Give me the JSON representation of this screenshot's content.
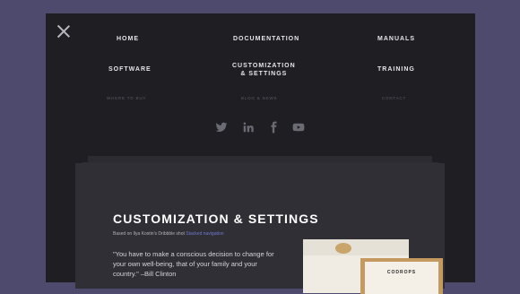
{
  "menu": {
    "primary": [
      {
        "id": "home",
        "label": "HOME"
      },
      {
        "id": "documentation",
        "label": "DOCUMENTATION"
      },
      {
        "id": "manuals",
        "label": "MANUALS"
      },
      {
        "id": "software",
        "label": "SOFTWARE"
      },
      {
        "id": "customization_1",
        "label": "CUSTOMIZATION"
      },
      {
        "id": "customization_2",
        "label": "& SETTINGS"
      },
      {
        "id": "training",
        "label": "TRAINING"
      }
    ],
    "secondary": [
      {
        "id": "where_to_buy",
        "label": "WHERE TO BUY"
      },
      {
        "id": "blog_news",
        "label": "BLOG & NEWS"
      },
      {
        "id": "contact",
        "label": "CONTACT"
      }
    ],
    "social": [
      {
        "id": "twitter",
        "icon": "twitter-icon"
      },
      {
        "id": "linkedin",
        "icon": "linkedin-icon"
      },
      {
        "id": "facebook",
        "icon": "facebook-icon"
      },
      {
        "id": "youtube",
        "icon": "youtube-icon"
      }
    ]
  },
  "card": {
    "title": "CUSTOMIZATION & SETTINGS",
    "credit_prefix": "Based on Ilya Kostin's Dribbble shot ",
    "credit_link": "Stacked navigation",
    "quote": "\"You have to make a conscious decision to change for your own well-being, that of your family and your country.\" –Bill Clinton",
    "product_label": "CODROPS"
  },
  "colors": {
    "background": "#4e4a6e",
    "menu_bg": "#1f1f23",
    "card_bg": "#2f2f35",
    "link": "#6f7ad1"
  }
}
